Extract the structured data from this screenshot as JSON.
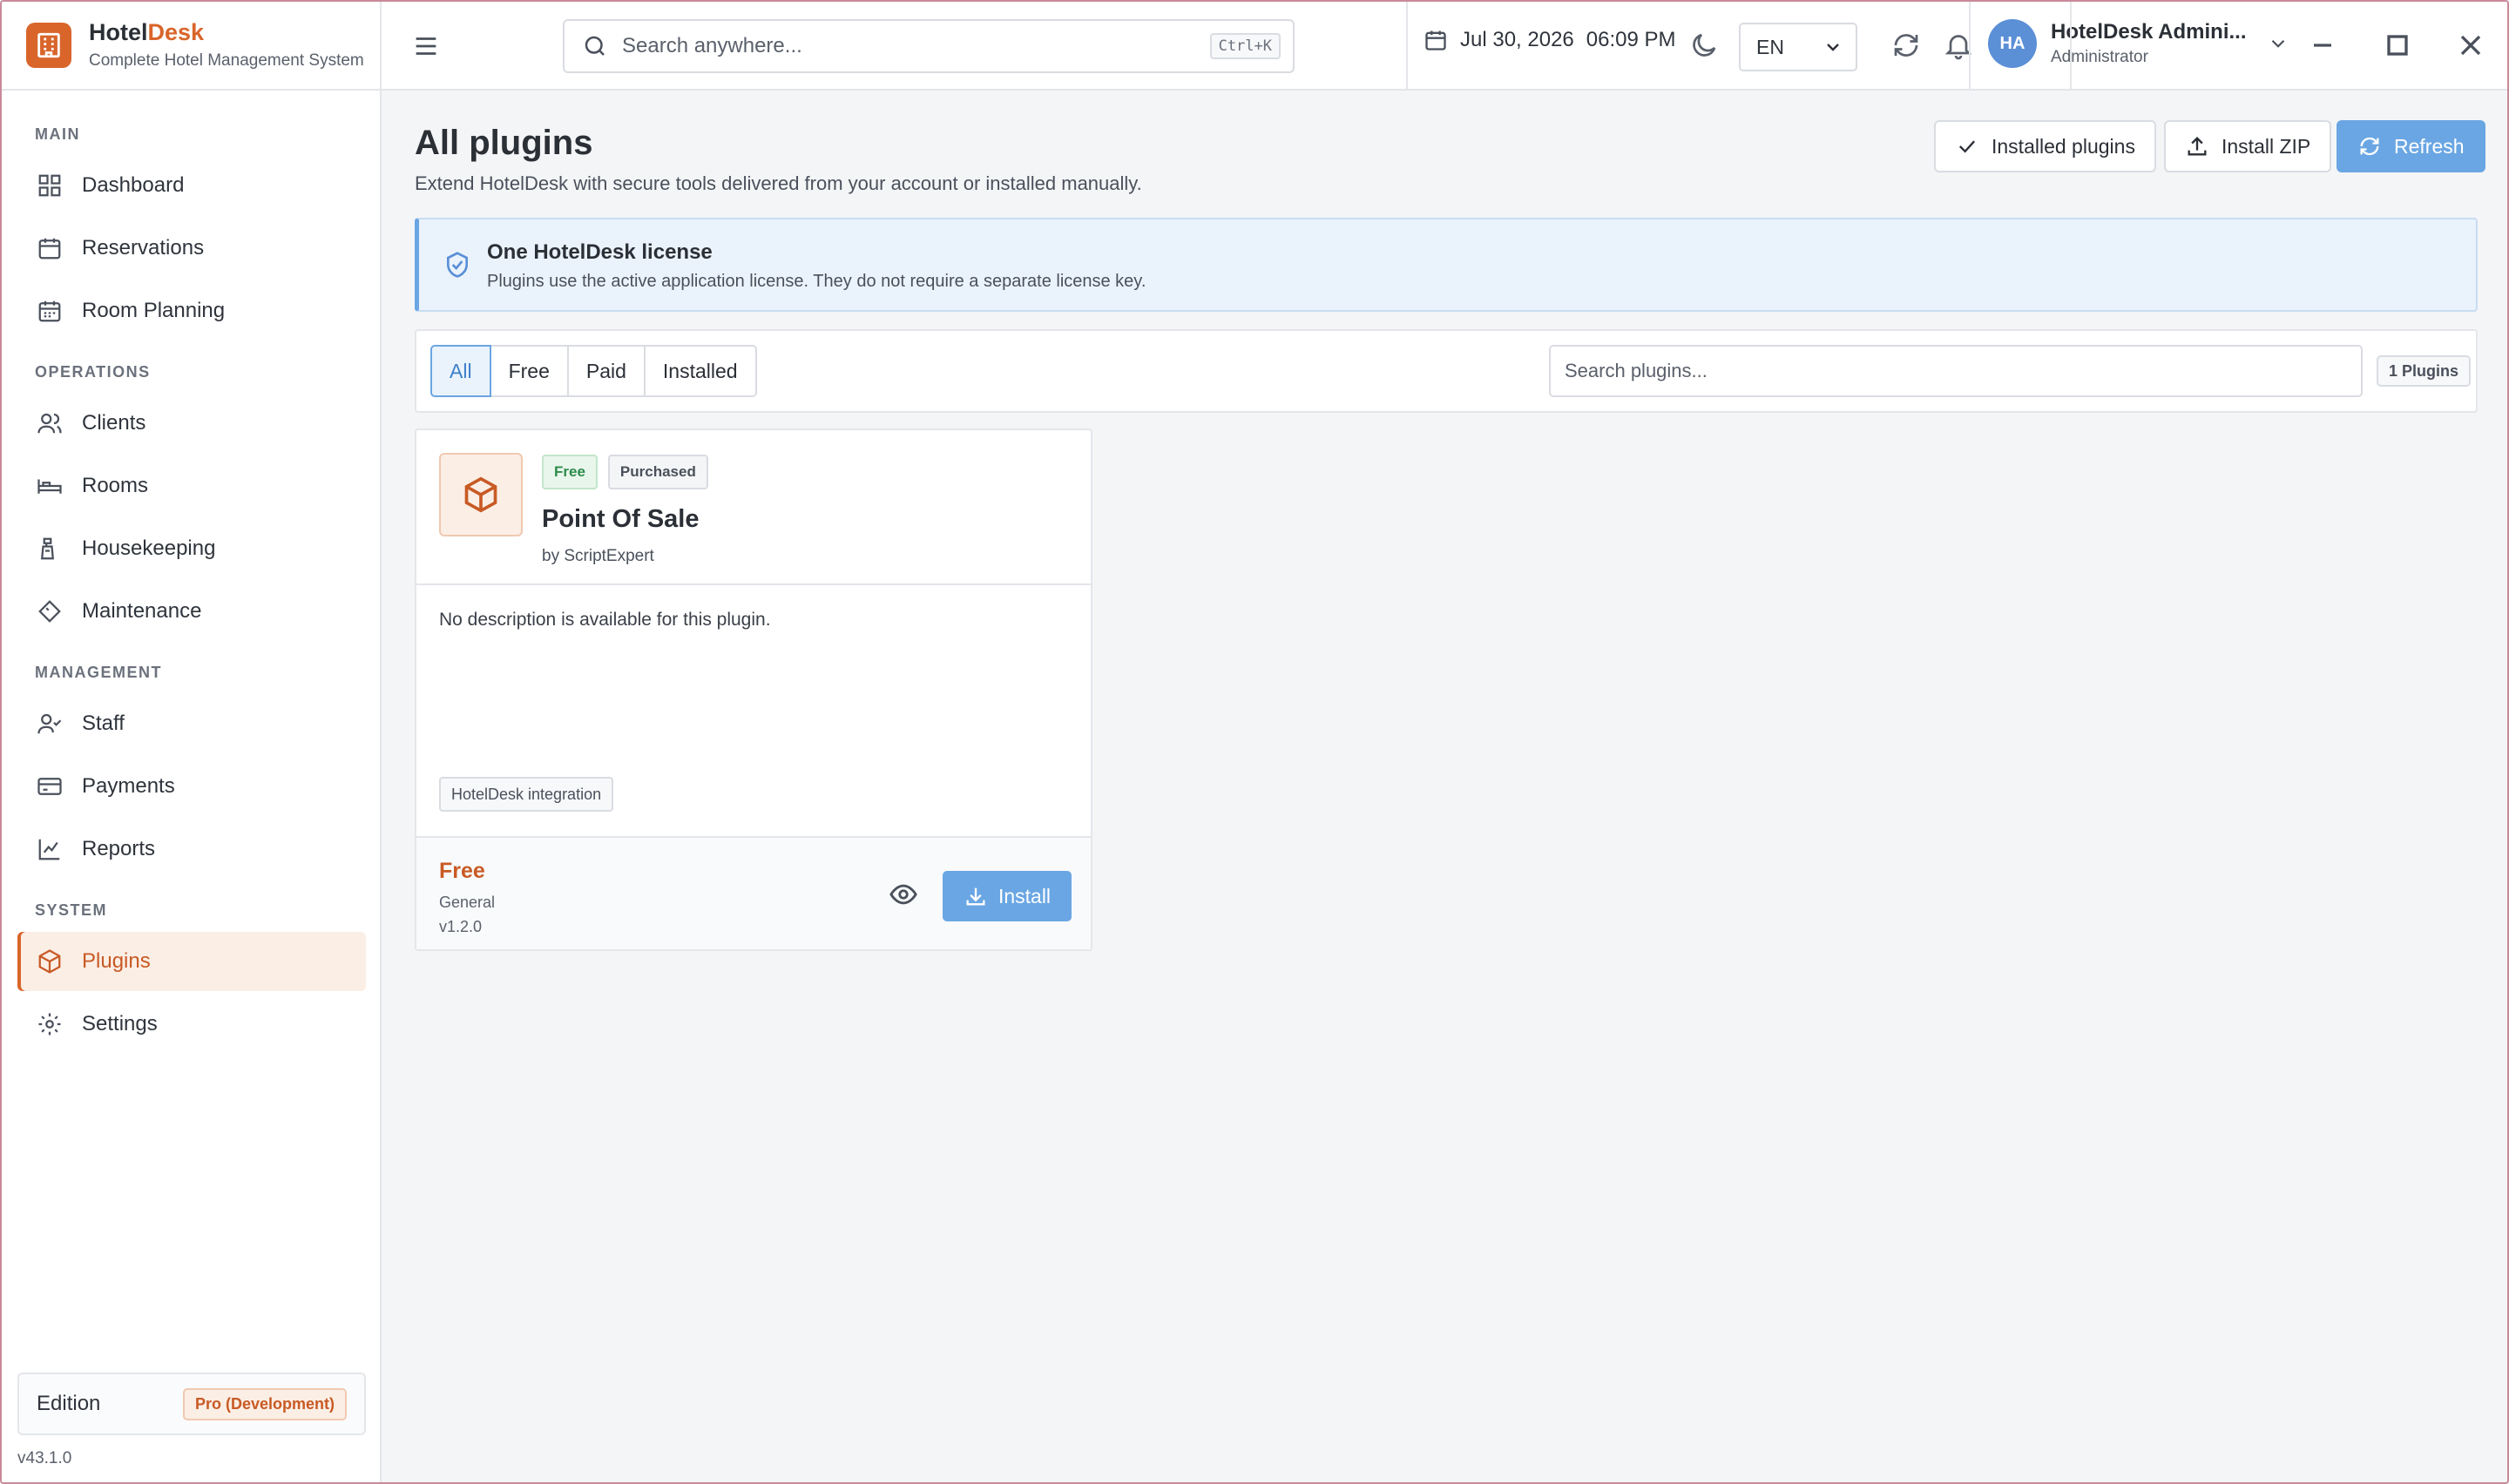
{
  "brand": {
    "name_prefix": "Hotel",
    "name_suffix": "Desk",
    "subtitle": "Complete Hotel Management System",
    "accent_color": "#d9652b"
  },
  "sidebar": {
    "sections": [
      {
        "title": "MAIN",
        "items": [
          {
            "label": "Dashboard",
            "icon": "dashboard-icon"
          },
          {
            "label": "Reservations",
            "icon": "calendar-icon"
          },
          {
            "label": "Room Planning",
            "icon": "calendar-grid-icon"
          }
        ]
      },
      {
        "title": "OPERATIONS",
        "items": [
          {
            "label": "Clients",
            "icon": "users-icon"
          },
          {
            "label": "Rooms",
            "icon": "bed-icon"
          },
          {
            "label": "Housekeeping",
            "icon": "broom-icon"
          },
          {
            "label": "Maintenance",
            "icon": "wrench-icon"
          }
        ]
      },
      {
        "title": "MANAGEMENT",
        "items": [
          {
            "label": "Staff",
            "icon": "user-check-icon"
          },
          {
            "label": "Payments",
            "icon": "credit-card-icon"
          },
          {
            "label": "Reports",
            "icon": "chart-line-icon"
          }
        ]
      },
      {
        "title": "SYSTEM",
        "items": [
          {
            "label": "Plugins",
            "icon": "package-icon",
            "active": true
          },
          {
            "label": "Settings",
            "icon": "gear-icon"
          }
        ]
      }
    ],
    "edition_label": "Edition",
    "edition_badge": "Pro (Development)",
    "version": "v43.1.0"
  },
  "topbar": {
    "search_placeholder": "Search anywhere...",
    "search_shortcut": "Ctrl+K",
    "date": "Jul 30, 2026",
    "time": "06:09 PM",
    "language": "EN",
    "user_initials": "HA",
    "user_name": "HotelDesk Admini...",
    "user_role": "Administrator"
  },
  "page": {
    "title": "All plugins",
    "subtitle": "Extend HotelDesk with secure tools delivered from your account or installed manually.",
    "buttons": {
      "installed": "Installed plugins",
      "install_zip": "Install ZIP",
      "refresh": "Refresh"
    },
    "notice": {
      "title": "One HotelDesk license",
      "text": "Plugins use the active application license. They do not require a separate license key."
    },
    "filters": [
      "All",
      "Free",
      "Paid",
      "Installed"
    ],
    "active_filter": "All",
    "plugin_search_placeholder": "Search plugins...",
    "plugin_count": "1 Plugins"
  },
  "plugins": [
    {
      "badge_free": "Free",
      "badge_purchased": "Purchased",
      "name": "Point Of Sale",
      "author": "by ScriptExpert",
      "description": "No description is available for this plugin.",
      "tag": "HotelDesk integration",
      "price": "Free",
      "category": "General",
      "version": "v1.2.0",
      "install_label": "Install"
    }
  ]
}
